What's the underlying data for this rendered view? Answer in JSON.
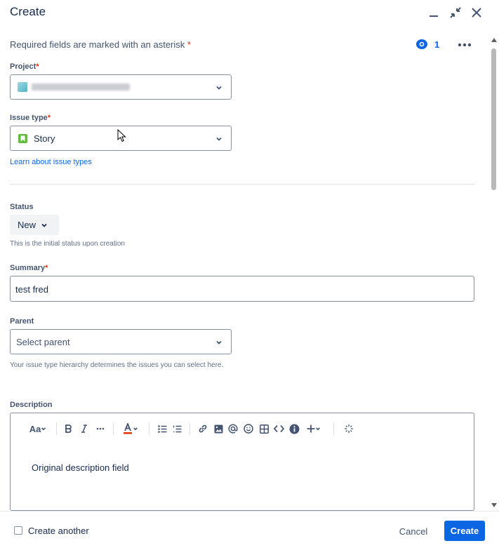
{
  "dialog": {
    "title": "Create",
    "required_note": "Required fields are marked with an asterisk",
    "asterisk": "*",
    "watchers_count": "1"
  },
  "fields": {
    "project": {
      "label": "Project"
    },
    "issue_type": {
      "label": "Issue type",
      "value": "Story",
      "learn_link": "Learn about issue types"
    },
    "status": {
      "label": "Status",
      "value": "New",
      "helper": "This is the initial status upon creation"
    },
    "summary": {
      "label": "Summary",
      "value": "test fred"
    },
    "parent": {
      "label": "Parent",
      "placeholder": "Select parent",
      "helper": "Your issue type hierarchy determines the issues you can select here."
    },
    "description": {
      "label": "Description",
      "value": "Original description field",
      "text_style": "Aa"
    }
  },
  "footer": {
    "create_another": "Create another",
    "cancel": "Cancel",
    "create": "Create"
  },
  "colors": {
    "primary": "#0c66e4",
    "story": "#63ba3c",
    "required": "#de350b"
  }
}
